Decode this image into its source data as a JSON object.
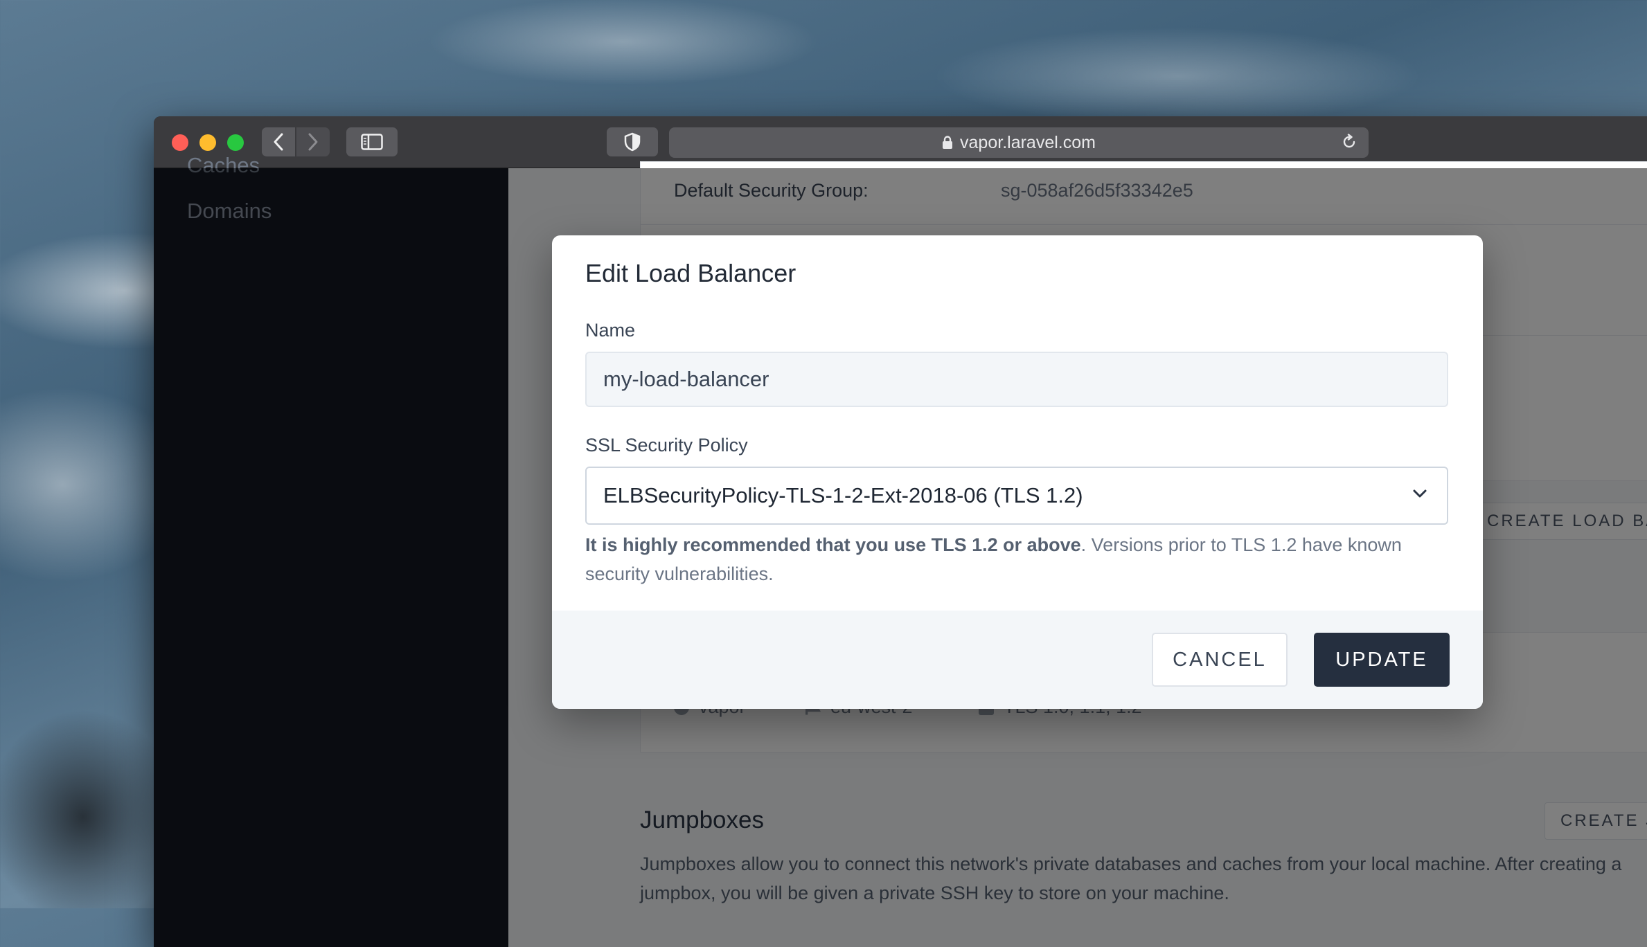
{
  "browser": {
    "url": "vapor.laravel.com"
  },
  "sidebar": {
    "cut_item": "Caches",
    "items": [
      {
        "label": "Domains"
      }
    ]
  },
  "network": {
    "default_sg_label": "Default Security Group:",
    "default_sg_value": "sg-058af26d5f33342e5",
    "create_load_balancer_label": "CREATE LOAD BA",
    "load_balancer_meta": {
      "network": "vapor",
      "region": "eu-west-2",
      "tls": "TLS 1.0, 1.1, 1.2"
    },
    "jumpboxes": {
      "title": "Jumpboxes",
      "create_label": "CREATE J",
      "description": "Jumpboxes allow you to connect this network's private databases and caches from your local machine. After creating a jumpbox, you will be given a private SSH key to store on your machine."
    }
  },
  "modal": {
    "title": "Edit Load Balancer",
    "name_label": "Name",
    "name_value": "my-load-balancer",
    "ssl_label": "SSL Security Policy",
    "ssl_selected": "ELBSecurityPolicy-TLS-1-2-Ext-2018-06 (TLS 1.2)",
    "help_strong": "It is highly recommended that you use TLS 1.2 or above",
    "help_rest": ". Versions prior to TLS 1.2 have known security vulnerabilities.",
    "cancel_label": "CANCEL",
    "update_label": "UPDATE"
  },
  "colors": {
    "update_button": "#252f3f",
    "sidebar_bg": "#141922",
    "close": "#ff5f57",
    "minimize": "#febc2e",
    "zoom": "#28c840"
  }
}
